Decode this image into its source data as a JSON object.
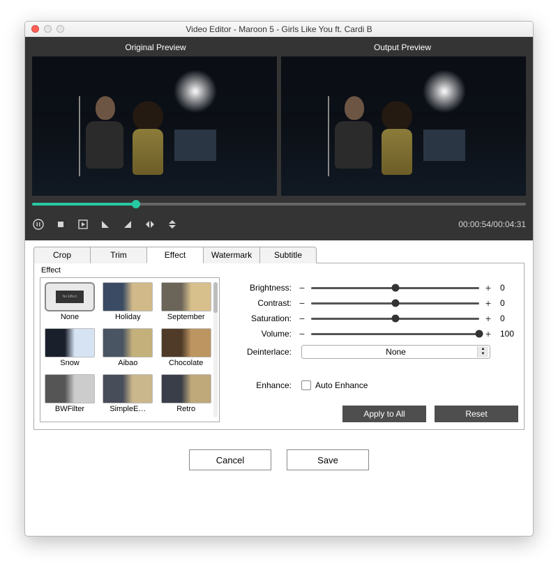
{
  "window": {
    "title": "Video Editor - Maroon 5 - Girls Like You ft. Cardi B"
  },
  "previews": {
    "original_label": "Original Preview",
    "output_label": "Output Preview"
  },
  "player": {
    "time_elapsed": "00:00:54",
    "time_total": "00:04:31",
    "seek_pct": 21,
    "icons": [
      "pause",
      "stop",
      "next-frame",
      "rotate-ccw",
      "rotate-cw",
      "flip-h",
      "flip-v"
    ]
  },
  "tabs": [
    "Crop",
    "Trim",
    "Effect",
    "Watermark",
    "Subtitle"
  ],
  "active_tab": "Effect",
  "effect_panel": {
    "title": "Effect",
    "effects": [
      {
        "name": "None",
        "selected": true,
        "thumb": "none"
      },
      {
        "name": "Holiday",
        "thumb": "a"
      },
      {
        "name": "September",
        "thumb": "b"
      },
      {
        "name": "Snow",
        "thumb": "c"
      },
      {
        "name": "Aibao",
        "thumb": "d"
      },
      {
        "name": "Chocolate",
        "thumb": "e"
      },
      {
        "name": "BWFilter",
        "thumb": "f"
      },
      {
        "name": "SimpleE…",
        "thumb": "g"
      },
      {
        "name": "Retro",
        "thumb": "h"
      }
    ],
    "sliders": [
      {
        "label": "Brightness:",
        "value": 0,
        "pct": 50
      },
      {
        "label": "Contrast:",
        "value": 0,
        "pct": 50
      },
      {
        "label": "Saturation:",
        "value": 0,
        "pct": 50
      },
      {
        "label": "Volume:",
        "value": 100,
        "pct": 100
      }
    ],
    "deinterlace": {
      "label": "Deinterlace:",
      "value": "None"
    },
    "enhance": {
      "label": "Enhance:",
      "checkbox_label": "Auto Enhance",
      "checked": false
    },
    "apply_all_label": "Apply to All",
    "reset_label": "Reset"
  },
  "footer": {
    "cancel_label": "Cancel",
    "save_label": "Save"
  }
}
